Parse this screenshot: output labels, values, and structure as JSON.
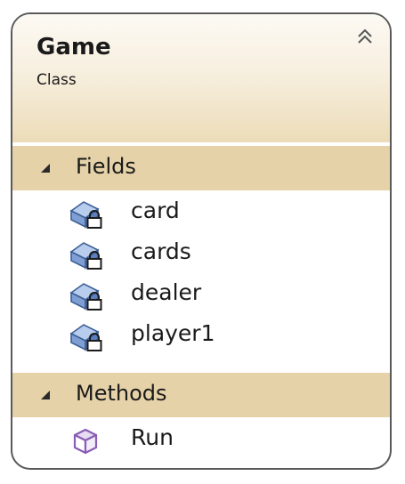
{
  "class_shape": {
    "title": "Game",
    "stereotype": "Class"
  },
  "fields_section": {
    "label": "Fields",
    "items": [
      {
        "name": "card",
        "icon": "private-field-icon"
      },
      {
        "name": "cards",
        "icon": "private-field-icon"
      },
      {
        "name": "dealer",
        "icon": "private-field-icon"
      },
      {
        "name": "player1",
        "icon": "private-field-icon"
      }
    ]
  },
  "methods_section": {
    "label": "Methods",
    "items": [
      {
        "name": "Run",
        "icon": "method-icon"
      }
    ]
  },
  "colors": {
    "header_gradient_bottom": "#ecdcb8",
    "section_band": "#e6d2a8",
    "field_icon_blue": "#6a8fc9",
    "method_icon_purple": "#8a5db5",
    "border": "#5a5a5a"
  }
}
